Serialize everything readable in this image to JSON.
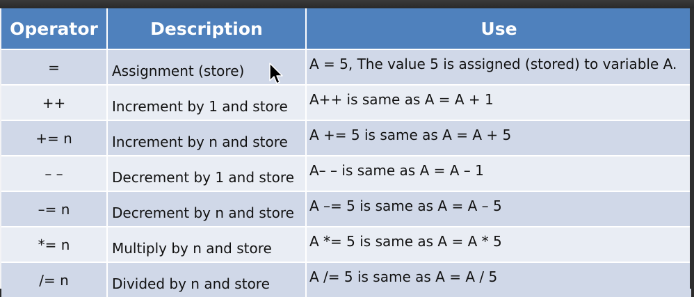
{
  "table": {
    "headers": [
      "Operator",
      "Description",
      "Use"
    ],
    "rows": [
      {
        "operator": "=",
        "description": "Assignment (store)",
        "use": "A = 5, The value 5 is assigned (stored) to variable A."
      },
      {
        "operator": "++",
        "description": "Increment by 1 and store",
        "use": "A++ is same as A = A + 1"
      },
      {
        "operator": "+= n",
        "description": "Increment by n and store",
        "use": "A += 5 is same as A = A + 5"
      },
      {
        "operator": "– –",
        "description": "Decrement by 1 and store",
        "use": "A– – is same as A = A – 1"
      },
      {
        "operator": "–= n",
        "description": "Decrement by n and store",
        "use": "A –= 5 is same as A = A – 5"
      },
      {
        "operator": "*= n",
        "description": "Multiply by n and store",
        "use": "A *= 5 is same as A = A * 5"
      },
      {
        "operator": "/= n",
        "description": "Divided by n and store",
        "use": "A /= 5 is same as A = A / 5"
      }
    ]
  },
  "colors": {
    "header": "#4f81bd",
    "row_dark": "#d0d8e8",
    "row_light": "#e9edf4"
  },
  "icons": {
    "cursor": "mouse-pointer-icon"
  }
}
